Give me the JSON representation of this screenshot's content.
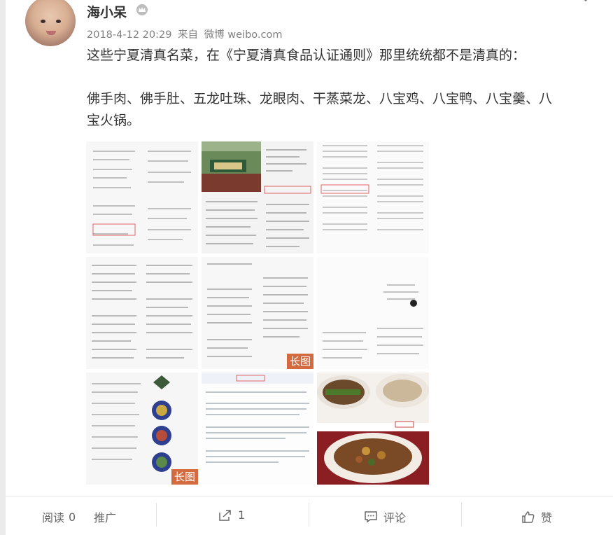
{
  "post": {
    "username": "海小呆",
    "timestamp": "2018-4-12 20:29",
    "source_prefix": "来自",
    "source": "微博 weibo.com",
    "line1": "这些宁夏清真名菜，在《宁夏清真食品认证通则》那里统统都不是清真的：",
    "line2": "佛手肉、佛手肚、五龙吐珠、龙眼肉、干蒸菜龙、八宝鸡、八宝鸭、八宝羹、八",
    "line3": "宝火锅。"
  },
  "images": {
    "long_label_1": "长图",
    "long_label_2": "长图"
  },
  "actions": {
    "read_label": "阅读",
    "read_count": "0",
    "promote_label": "推广",
    "share_count": "1",
    "comment_label": "评论",
    "like_label": "赞"
  },
  "icons": {
    "badge": "crown-badge-icon",
    "more": "chevron-down-icon",
    "share": "share-icon",
    "comment": "comment-icon",
    "like": "thumbs-up-icon"
  },
  "colors": {
    "long_label_bg": "#d46a3f",
    "text": "#333333",
    "meta": "#808080"
  }
}
